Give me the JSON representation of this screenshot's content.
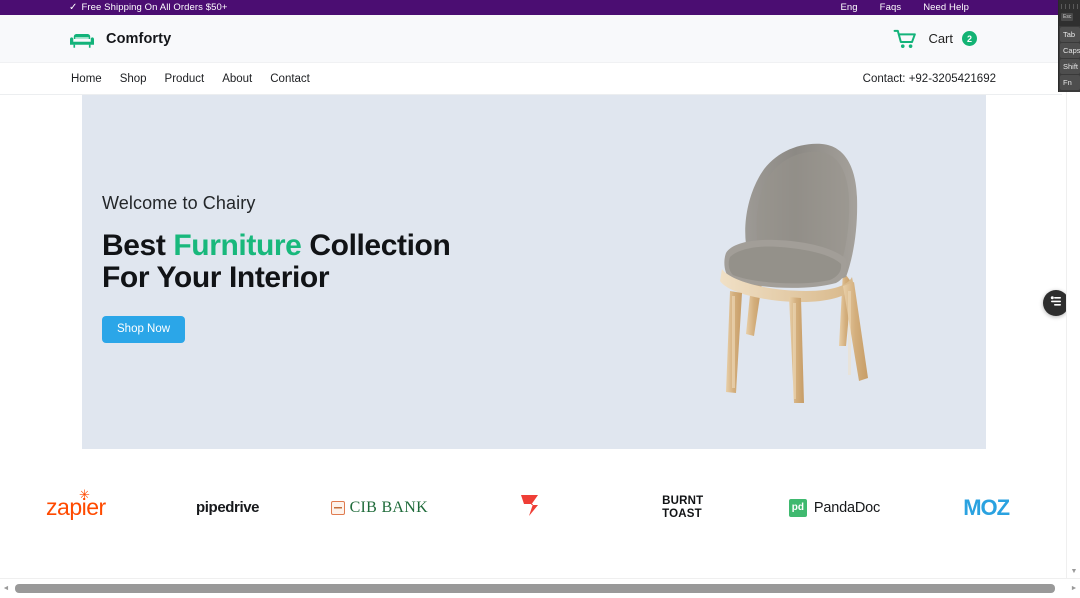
{
  "announcement": {
    "check_icon": "✓",
    "text": "Free Shipping On All Orders $50+",
    "links": [
      "Eng",
      "Faqs",
      "Need Help"
    ]
  },
  "header": {
    "brand_name": "Comforty",
    "brand_icon": "sofa-icon",
    "cart_icon": "shopping-cart-icon",
    "cart_label": "Cart",
    "cart_count": "2"
  },
  "nav": {
    "links": [
      "Home",
      "Shop",
      "Product",
      "About",
      "Contact"
    ],
    "contact": "Contact: +92-3205421692"
  },
  "hero": {
    "welcome": "Welcome to Chairy",
    "title_part1": "Best ",
    "title_accent": "Furniture",
    "title_part2": " Collection",
    "title_line2": "For Your Interior",
    "cta_label": "Shop Now",
    "product_image": "grey-upholstered-wooden-chair",
    "background_color": "#e0e6ef",
    "accent_color": "#18b87c",
    "cta_color": "#2ba6e8"
  },
  "logos": [
    {
      "name": "zapier",
      "text": "zapier",
      "color": "#ff4a00"
    },
    {
      "name": "pipedrive",
      "text": "pipedrive",
      "color": "#17191c"
    },
    {
      "name": "cib-bank",
      "text": "CIB BANK",
      "color": "#1f6b3a"
    },
    {
      "name": "zoomin-mark",
      "text": "",
      "color": "#ef3e36"
    },
    {
      "name": "burnt-toast",
      "text": "BURNT TOAST",
      "line1": "BURNT",
      "line2": "TOAST",
      "color": "#111315"
    },
    {
      "name": "pandadoc",
      "text": "PandaDoc",
      "badge": "pd",
      "color": "#3fb96f"
    },
    {
      "name": "moz",
      "text": "MOZ",
      "color": "#2aa2e0"
    }
  ],
  "fab": {
    "icon": "sliders-settings-icon",
    "background": "#2e2e2e"
  },
  "keyboard_overlay": {
    "keys": [
      "Esc",
      "Tab",
      "Caps",
      "Shift",
      "Fn"
    ]
  },
  "scrollbars": {
    "vertical_up": "▲",
    "vertical_down": "▼",
    "horizontal_left": "◄",
    "horizontal_right": "►"
  }
}
